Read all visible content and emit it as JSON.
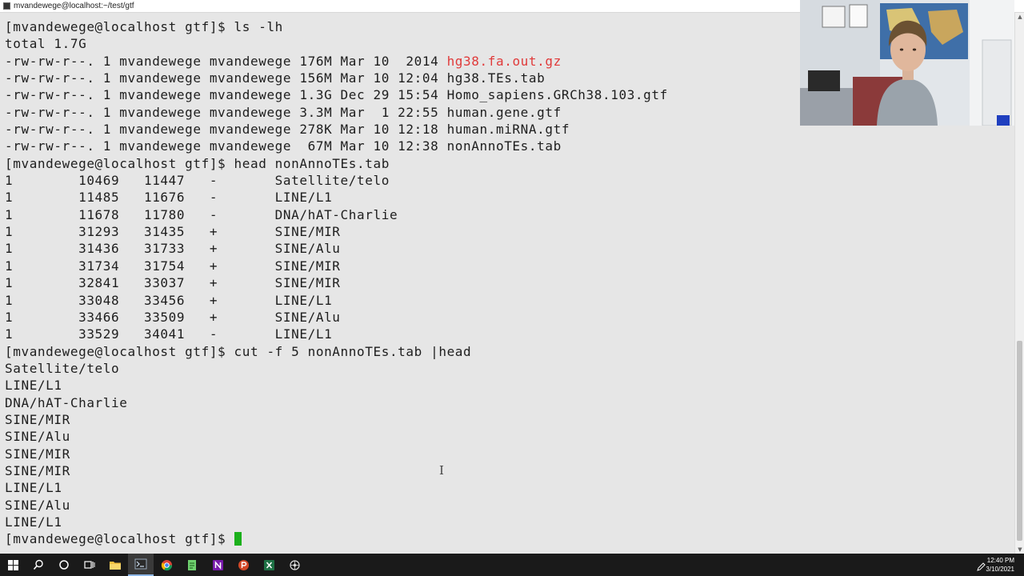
{
  "window": {
    "title": "mvandewege@localhost:~/test/gtf"
  },
  "terminal": {
    "lines": [
      {
        "text": "[mvandewege@localhost gtf]$ ls -lh"
      },
      {
        "text": "total 1.7G"
      },
      {
        "text": "-rw-rw-r--. 1 mvandewege mvandewege 176M Mar 10  2014 ",
        "highlight": "hg38.fa.out.gz"
      },
      {
        "text": "-rw-rw-r--. 1 mvandewege mvandewege 156M Mar 10 12:04 hg38.TEs.tab"
      },
      {
        "text": "-rw-rw-r--. 1 mvandewege mvandewege 1.3G Dec 29 15:54 Homo_sapiens.GRCh38.103.gtf"
      },
      {
        "text": "-rw-rw-r--. 1 mvandewege mvandewege 3.3M Mar  1 22:55 human.gene.gtf"
      },
      {
        "text": "-rw-rw-r--. 1 mvandewege mvandewege 278K Mar 10 12:18 human.miRNA.gtf"
      },
      {
        "text": "-rw-rw-r--. 1 mvandewege mvandewege  67M Mar 10 12:38 nonAnnoTEs.tab"
      },
      {
        "text": "[mvandewege@localhost gtf]$ head nonAnnoTEs.tab"
      },
      {
        "text": "1        10469   11447   -       Satellite/telo"
      },
      {
        "text": "1        11485   11676   -       LINE/L1"
      },
      {
        "text": "1        11678   11780   -       DNA/hAT-Charlie"
      },
      {
        "text": "1        31293   31435   +       SINE/MIR"
      },
      {
        "text": "1        31436   31733   +       SINE/Alu"
      },
      {
        "text": "1        31734   31754   +       SINE/MIR"
      },
      {
        "text": "1        32841   33037   +       SINE/MIR"
      },
      {
        "text": "1        33048   33456   +       LINE/L1"
      },
      {
        "text": "1        33466   33509   +       SINE/Alu"
      },
      {
        "text": "1        33529   34041   -       LINE/L1"
      },
      {
        "text": "[mvandewege@localhost gtf]$ cut -f 5 nonAnnoTEs.tab |head"
      },
      {
        "text": "Satellite/telo"
      },
      {
        "text": "LINE/L1"
      },
      {
        "text": "DNA/hAT-Charlie"
      },
      {
        "text": "SINE/MIR"
      },
      {
        "text": "SINE/Alu"
      },
      {
        "text": "SINE/MIR"
      },
      {
        "text": "SINE/MIR"
      },
      {
        "text": "LINE/L1"
      },
      {
        "text": "SINE/Alu"
      },
      {
        "text": "LINE/L1"
      }
    ],
    "prompt": "[mvandewege@localhost gtf]$ ",
    "colors": {
      "background": "#e6e6e6",
      "text": "#1e1e1e",
      "highlight": "#e03a3a",
      "cursor": "#1bb01b"
    }
  },
  "taskbar": {
    "icons": [
      "windows-start-icon",
      "search-icon",
      "cortana-icon",
      "task-view-icon",
      "file-explorer-icon",
      "terminal-app-icon",
      "chrome-icon",
      "notepad-icon",
      "onenote-icon",
      "powerpoint-icon",
      "excel-icon",
      "misc-app-icon"
    ],
    "clock_time": "12:40 PM",
    "clock_date": "3/10/2021"
  }
}
